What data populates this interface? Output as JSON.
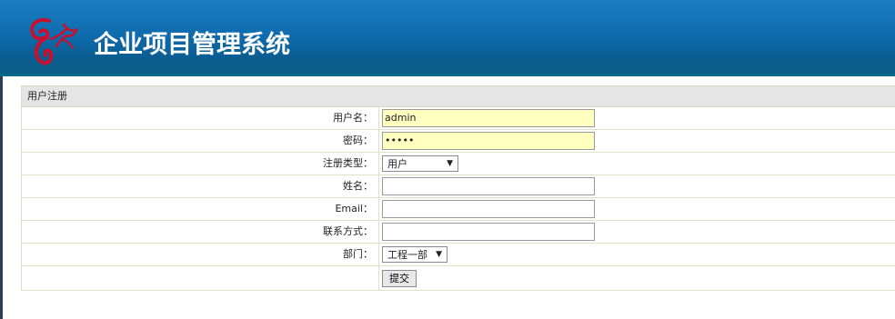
{
  "header": {
    "title": "企业项目管理系统",
    "logo_icon": "butterfly-logo",
    "bg_color": "#0f6cae",
    "logo_color": "#c8102e"
  },
  "form": {
    "title": "用户注册",
    "fields": {
      "username": {
        "label": "用户名：",
        "value": "admin"
      },
      "password": {
        "label": "密码：",
        "value": "•••••"
      },
      "register_type": {
        "label": "注册类型：",
        "selected": "用户"
      },
      "name": {
        "label": "姓名：",
        "value": ""
      },
      "email": {
        "label": "Email：",
        "value": ""
      },
      "contact": {
        "label": "联系方式：",
        "value": ""
      },
      "department": {
        "label": "部门：",
        "selected": "工程一部"
      }
    },
    "submit_label": "提交",
    "autofill_color": "#ffffc0"
  }
}
